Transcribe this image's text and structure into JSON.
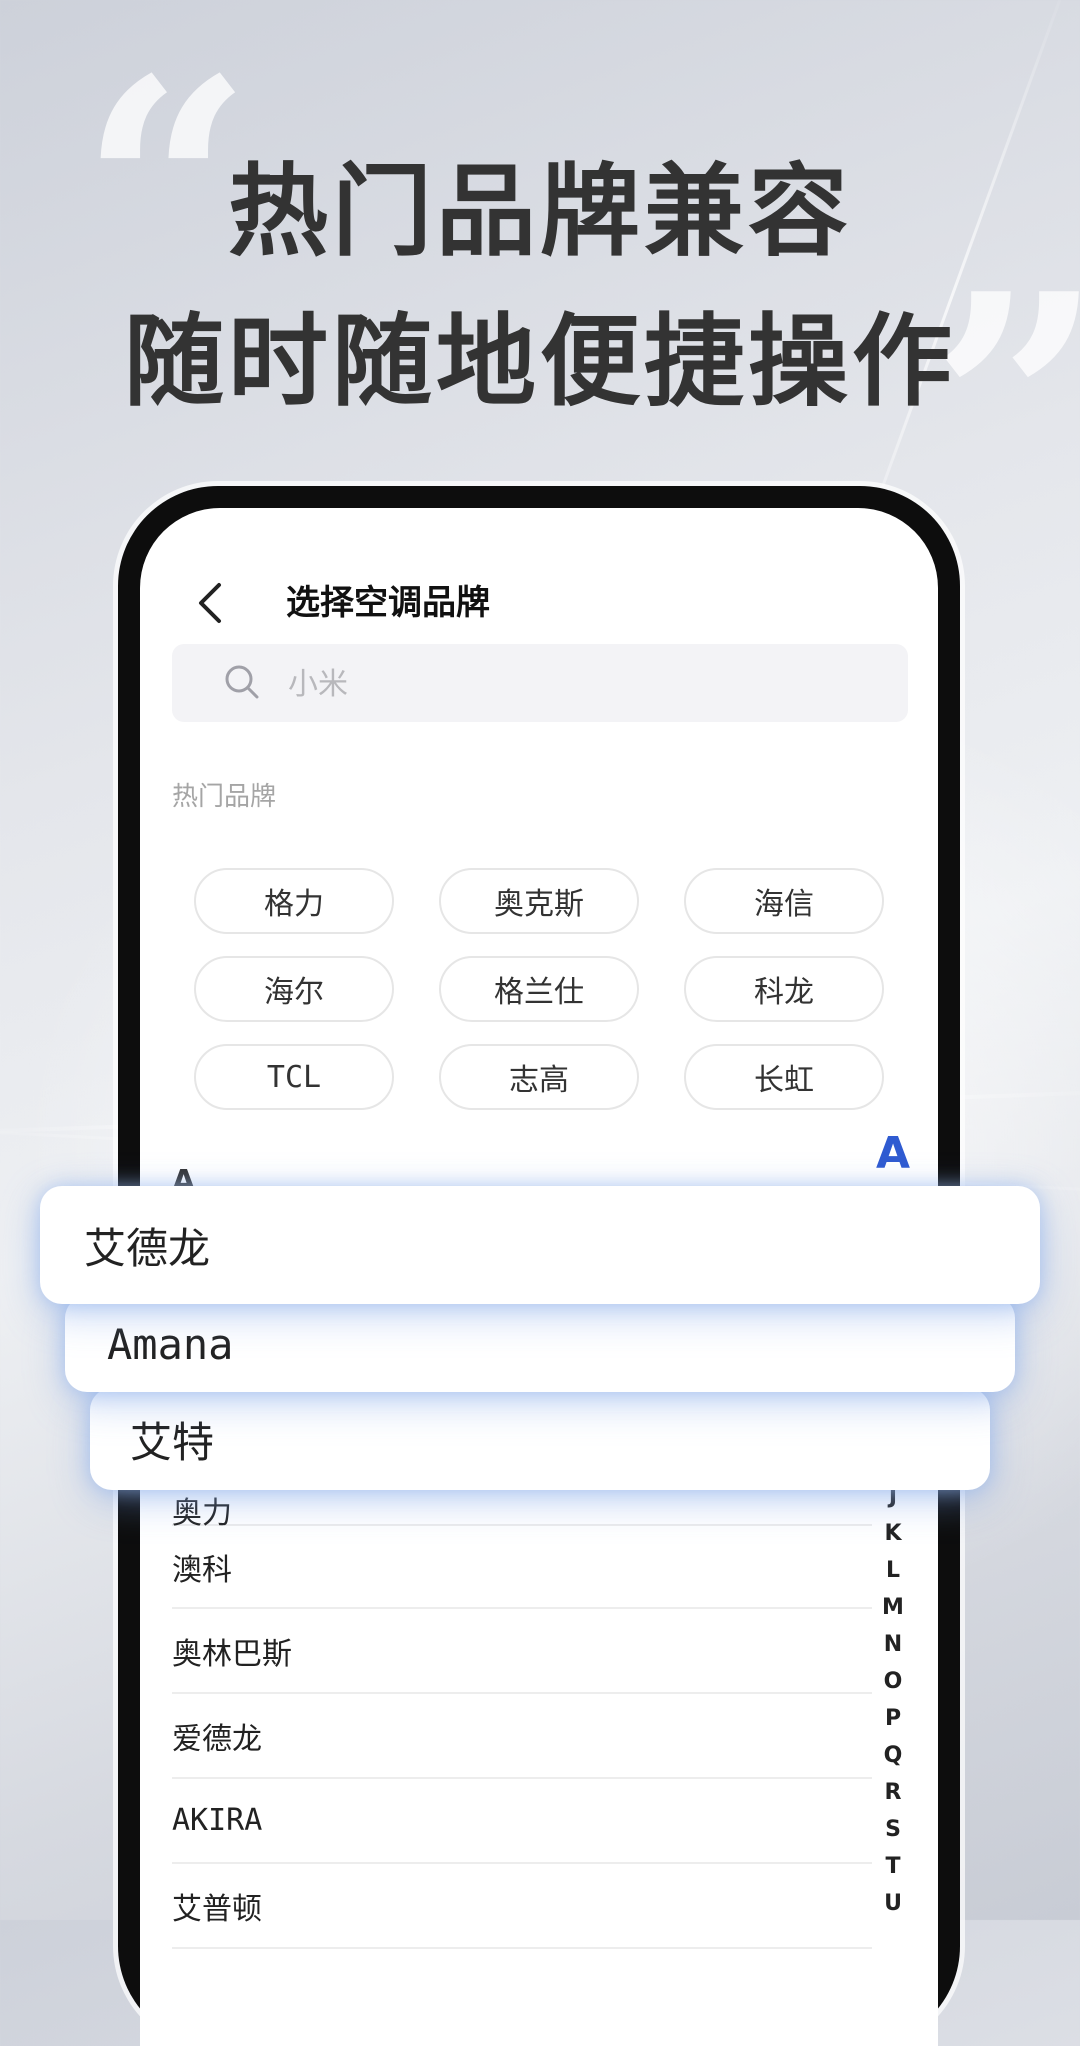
{
  "headline": {
    "line1": "热门品牌兼容",
    "line2": "随时随地便捷操作",
    "open_quote": "“",
    "close_quote": "”"
  },
  "nav": {
    "back_icon": "chevron-left-icon",
    "title": "选择空调品牌"
  },
  "search": {
    "icon": "search-icon",
    "placeholder": "小米"
  },
  "hot_brands": {
    "label": "热门品牌",
    "items": [
      "格力",
      "奥克斯",
      "海信",
      "海尔",
      "格兰仕",
      "科龙",
      "TCL",
      "志高",
      "长虹"
    ]
  },
  "list": {
    "current_letter": "A",
    "index_active": "A",
    "items": [
      "奥力",
      "澳科",
      "奥林巴斯",
      "爱德龙",
      "AKIRA",
      "艾普顿"
    ]
  },
  "alpha_index": [
    "J",
    "K",
    "L",
    "M",
    "N",
    "O",
    "P",
    "Q",
    "R",
    "S",
    "T",
    "U"
  ],
  "floating_cards": [
    "艾德龙",
    "Amana",
    "艾特"
  ],
  "colors": {
    "accent": "#2f5bd1",
    "headline_text": "#333333",
    "card_glow": "#a0bef0"
  }
}
